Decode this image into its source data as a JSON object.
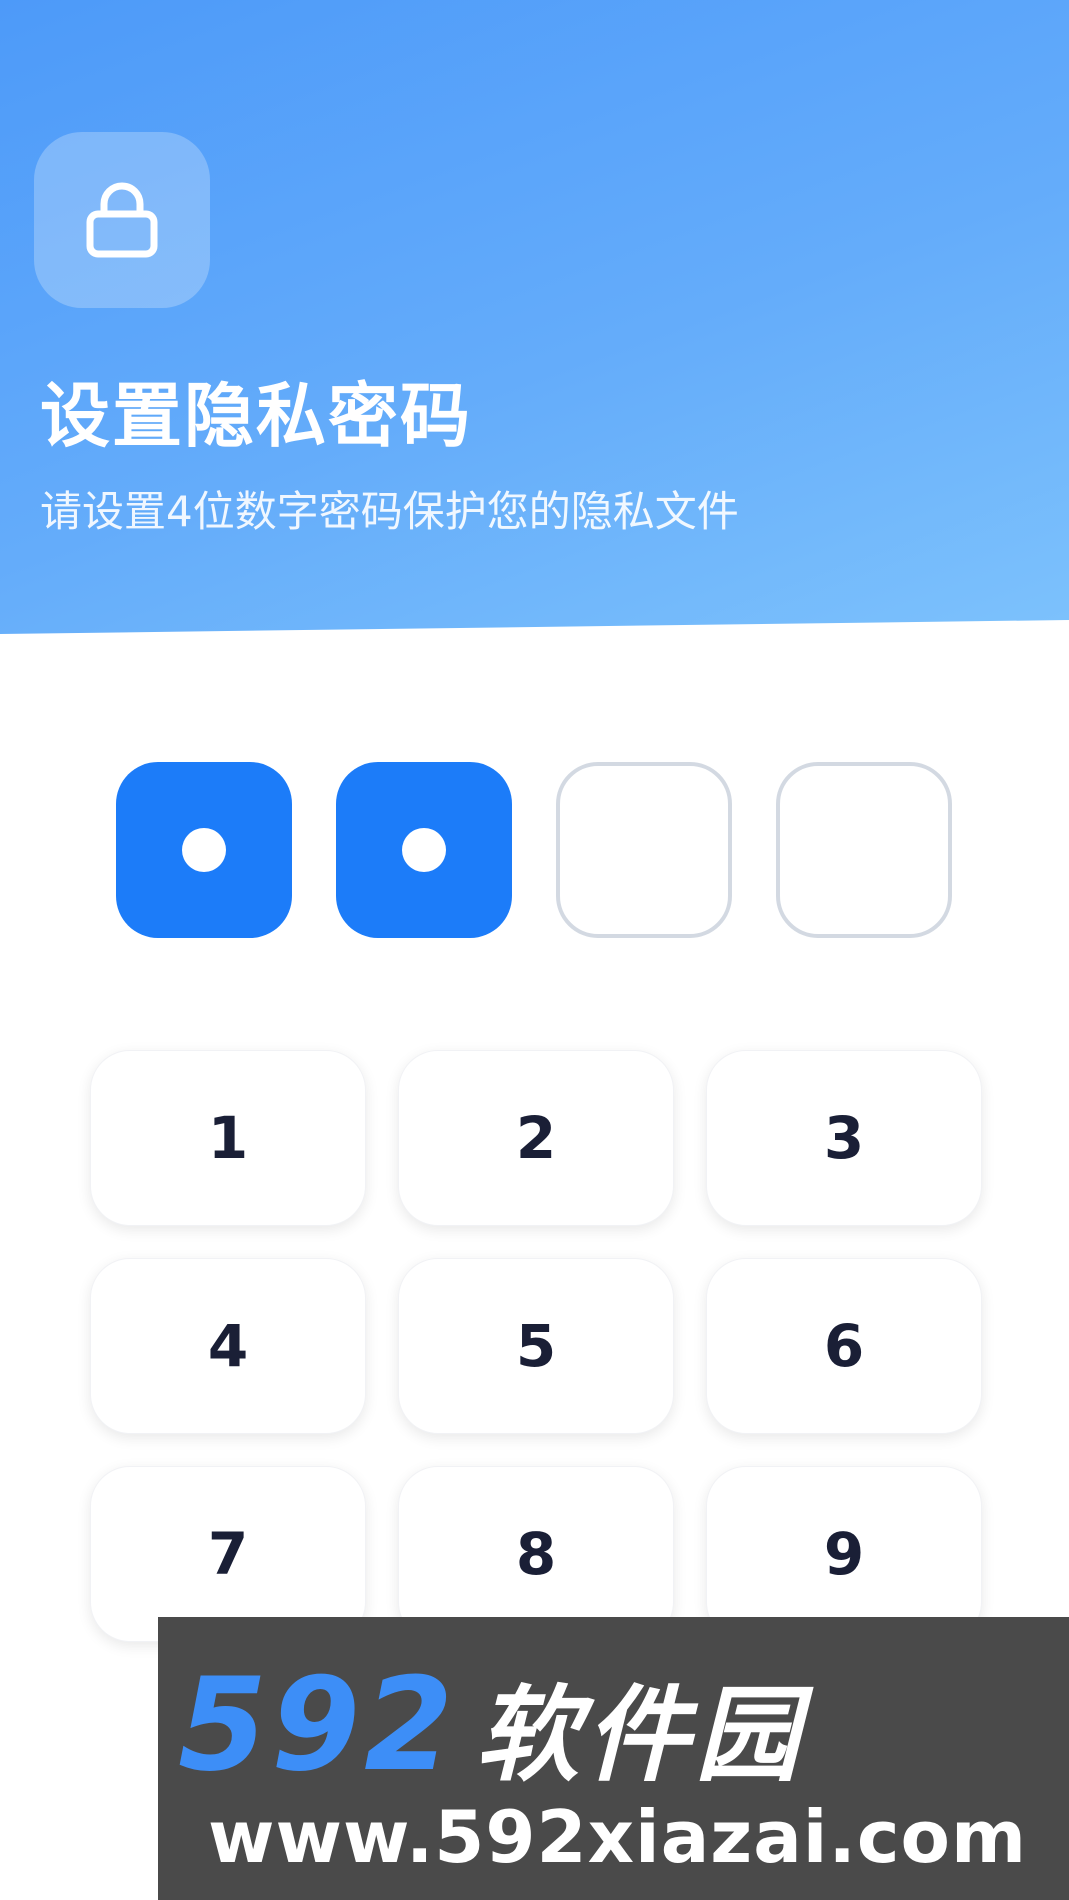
{
  "header": {
    "lock_icon": "lock-icon",
    "title": "设置隐私密码",
    "subtitle": "请设置4位数字密码保护您的隐私文件"
  },
  "pin": {
    "length": 4,
    "entered": 2
  },
  "keypad": {
    "keys": [
      "1",
      "2",
      "3",
      "4",
      "5",
      "6",
      "7",
      "8",
      "9"
    ]
  },
  "watermark": {
    "brand_number": "592",
    "brand_text": "软件园",
    "url": "www.592xiazai.com"
  },
  "colors": {
    "accent": "#1c7cf9",
    "header_gradient_start": "#4d9af9",
    "header_gradient_end": "#7dc2fc",
    "empty_border": "#d3d9e2",
    "key_text": "#1a1f36"
  }
}
